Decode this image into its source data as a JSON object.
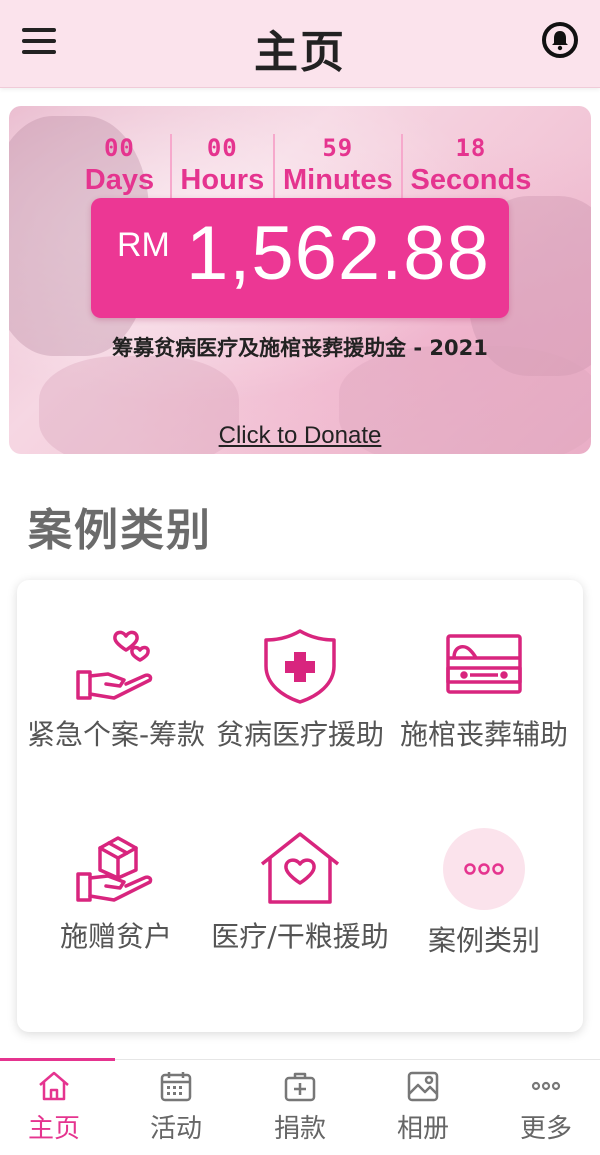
{
  "header": {
    "title": "主页",
    "menu_icon": "menu-icon",
    "bell_icon": "bell-icon"
  },
  "banner": {
    "countdown": [
      {
        "value": "00",
        "unit": "Days"
      },
      {
        "value": "00",
        "unit": "Hours"
      },
      {
        "value": "59",
        "unit": "Minutes"
      },
      {
        "value": "18",
        "unit": "Seconds"
      }
    ],
    "currency": "RM",
    "amount": "1,562.88",
    "campaign_title": "筹募贫病医疗及施棺丧葬援助金 - 2021",
    "donate_link": "Click to Donate"
  },
  "section": {
    "title": "案例类别"
  },
  "categories": [
    {
      "label": "紧急个案-筹款",
      "icon": "hand-hearts-icon"
    },
    {
      "label": "贫病医疗援助",
      "icon": "medical-shield-icon"
    },
    {
      "label": "施棺丧葬辅助",
      "icon": "coffin-icon"
    },
    {
      "label": "施赠贫户",
      "icon": "hand-package-icon"
    },
    {
      "label": "医疗/干粮援助",
      "icon": "house-heart-icon"
    },
    {
      "label": "案例类别",
      "icon": "more-dots-icon"
    }
  ],
  "bottom_nav": [
    {
      "label": "主页",
      "icon": "home-icon",
      "active": true
    },
    {
      "label": "活动",
      "icon": "calendar-icon",
      "active": false
    },
    {
      "label": "捐款",
      "icon": "donate-box-icon",
      "active": false
    },
    {
      "label": "相册",
      "icon": "gallery-icon",
      "active": false
    },
    {
      "label": "更多",
      "icon": "more-icon",
      "active": false
    }
  ],
  "colors": {
    "accent": "#e5348f",
    "amount_bg": "#ec3794",
    "header_bg": "#fbe3ec",
    "label_gray": "#555555"
  }
}
